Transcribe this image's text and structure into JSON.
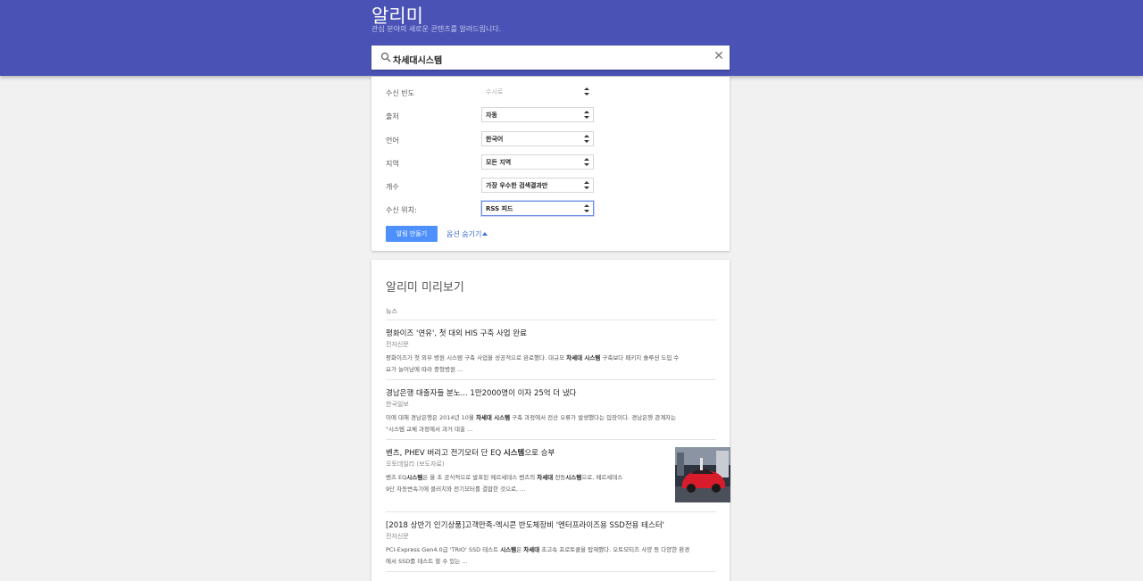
{
  "header": {
    "title": "알리미",
    "subtitle": "관심 분야의 새로운 콘텐츠를 알려드립니다."
  },
  "search": {
    "value": "차세대시스템"
  },
  "options": {
    "frequency": {
      "label": "수신 빈도",
      "value": "수시로"
    },
    "source": {
      "label": "출처",
      "value": "자동"
    },
    "language": {
      "label": "언어",
      "value": "한국어"
    },
    "region": {
      "label": "지역",
      "value": "모든 지역"
    },
    "count": {
      "label": "개수",
      "value": "가장 우수한 검색결과만"
    },
    "deliver": {
      "label": "수신 위치:",
      "value": "RSS 피드"
    },
    "create_button": "알림 만들기",
    "hide_options": "옵션 숨기기"
  },
  "preview": {
    "title": "알리미 미리보기",
    "section": "뉴스",
    "articles": [
      {
        "title": "평화이즈 '연유', 첫 대외 HIS 구축 사업 완료",
        "source": "전자신문",
        "line1_a": "평화이즈가 첫 외부 병원 시스템 구축 사업을 성공적으로 완료했다. 대규모 ",
        "line1_b": "차세대 시스템",
        "line1_c": " 구축보다 패키지 솔루션 도입 수",
        "line2": "요가 늘어남에 따라 중형병원 ..."
      },
      {
        "title": "경남은행 대출자들 분노... 1만2000명이 이자 25억 더 냈다",
        "source": "한국일보",
        "line1_a": "이에 대해 경남은행은 2014년 10월 ",
        "line1_b": "차세대 시스템",
        "line1_c": " 구축 과정에서 전산 오류가 발생했다는 입장이다. 경남은행 관계자는",
        "line2": "\"시스템 교체 과정에서 과거 대출 ..."
      },
      {
        "title_a": "벤츠, PHEV 버리고 전기모터 단 EQ ",
        "title_b": "시스템",
        "title_c": "으로 승부",
        "source": "오토데일리 (보도자료)",
        "line1_a": "벤츠 EQ",
        "line1_b": "시스템",
        "line1_c": "은 올 초 공식적으로 발표된 메르세데스 벤츠의 ",
        "line1_d": "차세대",
        "line1_e": " 전동",
        "line1_f": "시스템",
        "line1_g": "으로, 메르세데스",
        "line2": "9단 자동변속기에 클러치와 전기모터를 결합한 것으로, ..."
      },
      {
        "title": "[2018 상반기 인기상품]고객만족-엑시콘 반도체장비 '엔터프라이즈용 SSD전용 테스터'",
        "source": "전자신문",
        "line1_a": "PCI-Express Gen4.0급 'TRIO' SSD 테스트 ",
        "line1_b": "시스템",
        "line1_c": "은 ",
        "line1_d": "차세대",
        "line1_e": " 초고속 프로토콜을 탑재했다. 오토모티즈 사양 등 다양한 환경",
        "line2": "에서 SSD를 테스트 할 수 있는 ..."
      }
    ]
  },
  "colors": {
    "header_bg": "#4a52b5",
    "accent_button": "#4d90fe",
    "link": "#3f6fd6"
  }
}
